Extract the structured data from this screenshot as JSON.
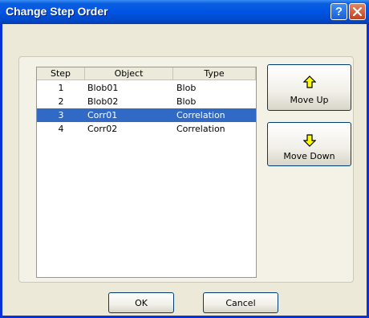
{
  "window": {
    "title": "Change Step Order"
  },
  "title_buttons": {
    "help_glyph": "?"
  },
  "list": {
    "columns": [
      "Step",
      "Object",
      "Type"
    ],
    "rows": [
      {
        "step": "1",
        "object": "Blob01",
        "type": "Blob",
        "selected": false
      },
      {
        "step": "2",
        "object": "Blob02",
        "type": "Blob",
        "selected": false
      },
      {
        "step": "3",
        "object": "Corr01",
        "type": "Correlation",
        "selected": true
      },
      {
        "step": "4",
        "object": "Corr02",
        "type": "Correlation",
        "selected": false
      }
    ]
  },
  "buttons": {
    "move_up": "Move Up",
    "move_down": "Move Down",
    "ok": "OK",
    "cancel": "Cancel"
  },
  "colors": {
    "selection": "#316ac5",
    "arrow_fill": "#ffff00",
    "titlebar": "#0054e3"
  }
}
